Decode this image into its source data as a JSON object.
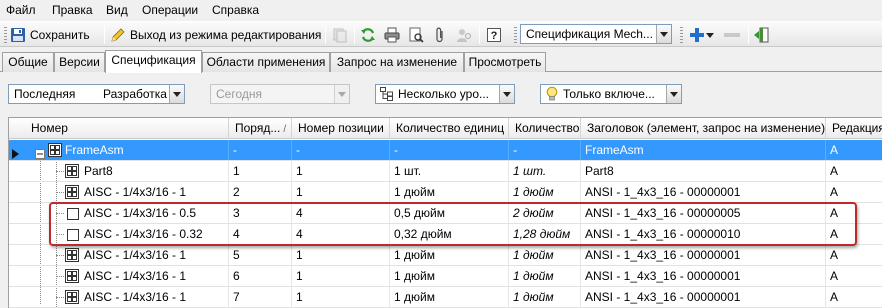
{
  "menu": {
    "items": [
      "Файл",
      "Правка",
      "Вид",
      "Операции",
      "Справка"
    ]
  },
  "toolbar": {
    "save_label": "Сохранить",
    "exit_edit_label": "Выход из режима редактирования",
    "spec_select_value": "Спецификация Mech..."
  },
  "tabs": [
    "Общие",
    "Версии",
    "Спецификация",
    "Области применения",
    "Запрос на изменение",
    "Просмотреть"
  ],
  "active_tab": "Спецификация",
  "filters": {
    "revision_left": "Последняя",
    "revision_right": "Разработка",
    "date": "Сегодня",
    "levels": "Несколько уро...",
    "display": "Только включе..."
  },
  "grid": {
    "columns": [
      "Номер",
      "Поряд...",
      "Номер позиции",
      "Количество единиц",
      "Количество",
      "Заголовок (элемент, запрос на изменение)",
      "Редакция"
    ],
    "sort_indicator": "/",
    "rows": [
      {
        "name": "FrameAsm",
        "order": "-",
        "position": "-",
        "units": "-",
        "qty": "-",
        "title": "FrameAsm",
        "rev": "A"
      },
      {
        "name": "Part8",
        "order": "1",
        "position": "1",
        "units": "1 шт.",
        "qty": "1 шт.",
        "title": "Part8",
        "rev": "A"
      },
      {
        "name": "AISC - 1/4x3/16 - 1",
        "order": "2",
        "position": "1",
        "units": "1 дюйм",
        "qty": "1 дюйм",
        "title": "ANSI - 1_4x3_16 - 00000001",
        "rev": "A"
      },
      {
        "name": "AISC - 1/4x3/16 - 0.5",
        "order": "3",
        "position": "4",
        "units": "0,5 дюйм",
        "qty": "2 дюйм",
        "title": "ANSI - 1_4x3_16 - 00000005",
        "rev": "A"
      },
      {
        "name": "AISC - 1/4x3/16 - 0.32",
        "order": "4",
        "position": "4",
        "units": "0,32 дюйм",
        "qty": "1,28 дюйм",
        "title": "ANSI - 1_4x3_16 - 00000010",
        "rev": "A"
      },
      {
        "name": "AISC - 1/4x3/16 - 1",
        "order": "5",
        "position": "1",
        "units": "1 дюйм",
        "qty": "1 дюйм",
        "title": "ANSI - 1_4x3_16 - 00000001",
        "rev": "A"
      },
      {
        "name": "AISC - 1/4x3/16 - 1",
        "order": "6",
        "position": "1",
        "units": "1 дюйм",
        "qty": "1 дюйм",
        "title": "ANSI - 1_4x3_16 - 00000001",
        "rev": "A"
      },
      {
        "name": "AISC - 1/4x3/16 - 1",
        "order": "7",
        "position": "1",
        "units": "1 дюйм",
        "qty": "1 дюйм",
        "title": "ANSI - 1_4x3_16 - 00000001",
        "rev": "A"
      }
    ]
  },
  "colors": {
    "selection": "#3399ff",
    "highlight_border": "#c0282c",
    "accent_blue": "#1e6fd0"
  }
}
